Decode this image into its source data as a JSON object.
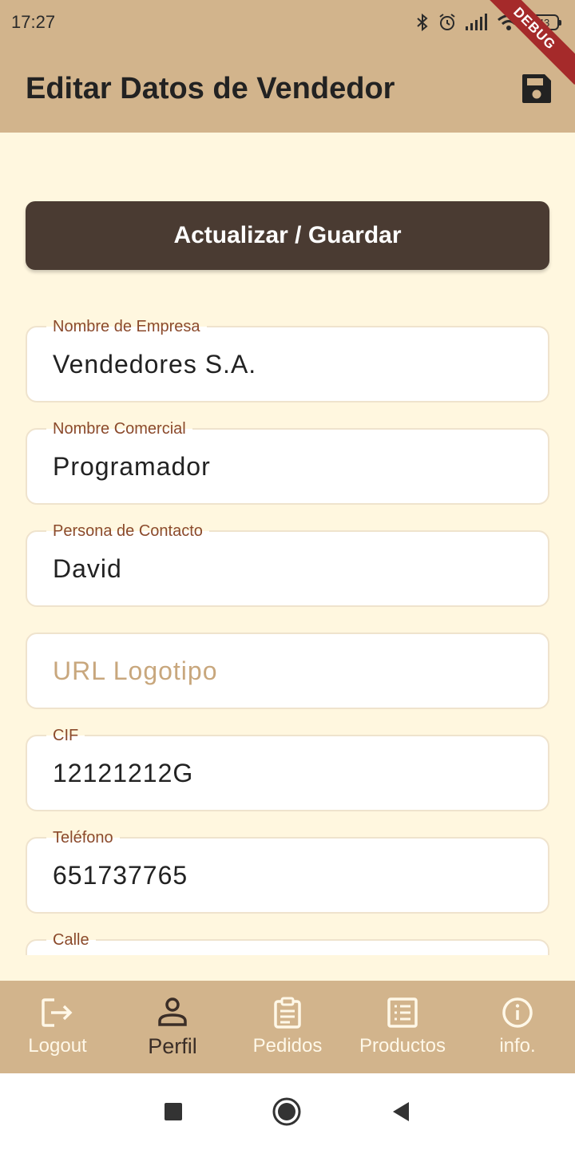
{
  "status_bar": {
    "time": "17:27",
    "battery": "43"
  },
  "debug_banner": "DEBUG",
  "app_bar": {
    "title": "Editar Datos de Vendedor",
    "save_icon": "save-icon"
  },
  "primary_button": {
    "label": "Actualizar / Guardar"
  },
  "fields": {
    "empresa": {
      "label": "Nombre de Empresa",
      "value": "Vendedores S.A."
    },
    "comercial": {
      "label": "Nombre Comercial",
      "value": "Programador"
    },
    "contacto": {
      "label": "Persona de Contacto",
      "value": "David"
    },
    "logo": {
      "placeholder": "URL Logotipo",
      "value": ""
    },
    "cif": {
      "label": "CIF",
      "value": "12121212G"
    },
    "telefono": {
      "label": "Teléfono",
      "value": "651737765"
    },
    "calle": {
      "label": "Calle",
      "value": ""
    }
  },
  "bottom_nav": {
    "items": [
      {
        "label": "Logout",
        "icon": "logout-icon"
      },
      {
        "label": "Perfil",
        "icon": "person-icon",
        "active": true
      },
      {
        "label": "Pedidos",
        "icon": "clipboard-icon"
      },
      {
        "label": "Productos",
        "icon": "list-icon"
      },
      {
        "label": "info.",
        "icon": "info-icon"
      }
    ]
  },
  "colors": {
    "app_bar": "#d2b48c",
    "background": "#fff7df",
    "button": "#4a3b32",
    "label": "#8b4a2b",
    "placeholder": "#c8a77d"
  }
}
